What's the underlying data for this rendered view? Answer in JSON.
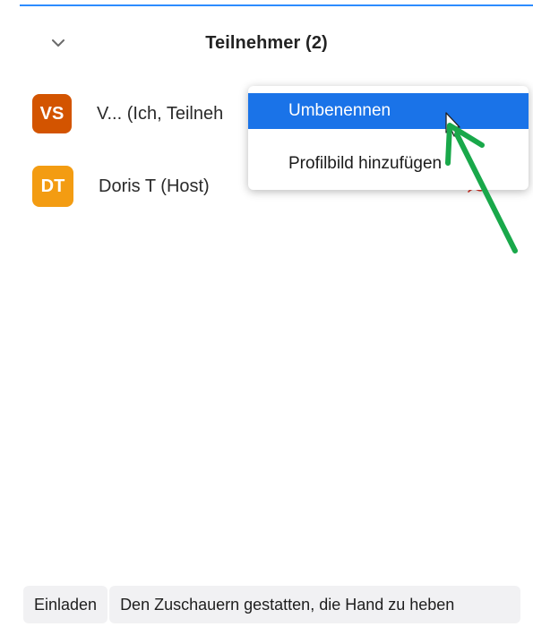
{
  "header": {
    "title": "Teilnehmer (2)",
    "collapse_icon": "chevron-down-icon"
  },
  "participants": [
    {
      "initials": "VS",
      "name": "V... (Ich, Teilneh",
      "avatar_color": "#d35400"
    },
    {
      "initials": "DT",
      "name": "Doris T (Host)",
      "avatar_color": "#f39c12"
    }
  ],
  "context_menu": {
    "items": [
      {
        "label": "Umbenennen",
        "highlighted": true
      },
      {
        "label": "Profilbild hinzufügen",
        "highlighted": false
      }
    ],
    "highlight_color": "#1a73e8"
  },
  "annotation": {
    "icon": "green-arrow-icon",
    "color": "#19a84a"
  },
  "footer": {
    "invite_label": "Einladen",
    "raise_hand_label": "Den Zuschauern gestatten, die Hand zu heben"
  },
  "colors": {
    "accent": "#2d8cff"
  }
}
